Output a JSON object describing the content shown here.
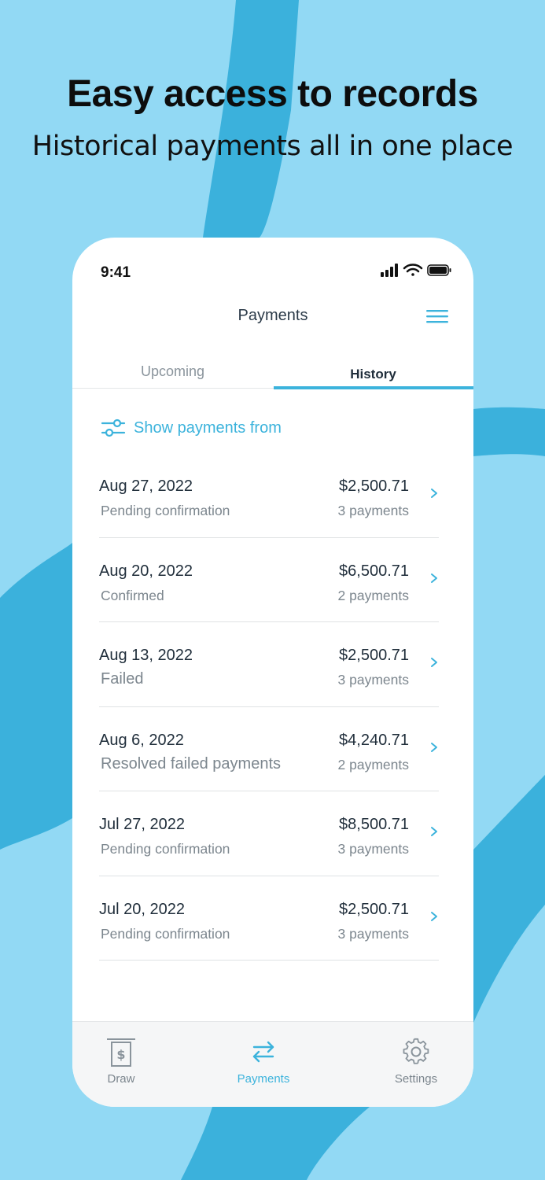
{
  "promo": {
    "headline": "Easy access to records",
    "subline": "Historical payments all in one place"
  },
  "status_bar": {
    "time": "9:41"
  },
  "navbar": {
    "title": "Payments",
    "menu_icon": "hamburger-icon"
  },
  "tabs": [
    {
      "label": "Upcoming",
      "selected": false
    },
    {
      "label": "History",
      "selected": true
    }
  ],
  "filter": {
    "label": "Show payments from",
    "icon": "sliders-icon"
  },
  "payments": [
    {
      "date": "Aug 27, 2022",
      "status": "Pending confirmation",
      "amount": "$2,500.71",
      "count": "3 payments"
    },
    {
      "date": "Aug 20, 2022",
      "status": "Confirmed",
      "amount": "$6,500.71",
      "count": "2 payments"
    },
    {
      "date": "Aug 13, 2022",
      "status": "Failed",
      "amount": "$2,500.71",
      "count": "3 payments"
    },
    {
      "date": "Aug 6, 2022",
      "status": "Resolved failed payments",
      "amount": "$4,240.71",
      "count": "2 payments"
    },
    {
      "date": "Jul 27, 2022",
      "status": "Pending confirmation",
      "amount": "$8,500.71",
      "count": "3 payments"
    },
    {
      "date": "Jul 20, 2022",
      "status": "Pending confirmation",
      "amount": "$2,500.71",
      "count": "3 payments"
    }
  ],
  "tabbar": [
    {
      "label": "Draw",
      "icon": "dollar-bill-icon",
      "active": false
    },
    {
      "label": "Payments",
      "icon": "transfer-arrows-icon",
      "active": true
    },
    {
      "label": "Settings",
      "icon": "gear-icon",
      "active": false
    }
  ],
  "colors": {
    "background": "#92d9f4",
    "swirl": "#3bb1dc",
    "accent": "#3cb3dc",
    "text_dark": "#1f2d3a",
    "text_muted": "#7c868e"
  }
}
